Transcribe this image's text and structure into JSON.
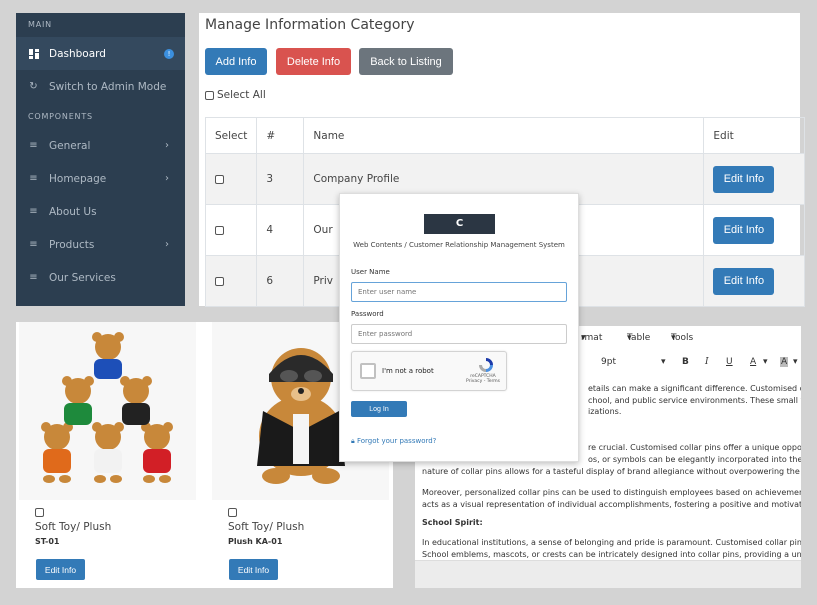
{
  "sidebar": {
    "section_main": "MAIN",
    "section_components": "COMPONENTS",
    "items_main": [
      {
        "label": "Dashboard",
        "badge": "!"
      },
      {
        "label": "Switch to Admin Mode"
      }
    ],
    "items_components": [
      {
        "label": "General"
      },
      {
        "label": "Homepage"
      },
      {
        "label": "About Us"
      },
      {
        "label": "Products"
      },
      {
        "label": "Our Services"
      }
    ]
  },
  "manage": {
    "title": "Manage Information Category",
    "add_label": "Add Info",
    "delete_label": "Delete Info",
    "back_label": "Back to Listing",
    "select_all": "Select All",
    "columns": [
      "Select",
      "#",
      "Name",
      "Edit"
    ],
    "rows": [
      {
        "num": "3",
        "name": "Company Profile",
        "edit": "Edit Info"
      },
      {
        "num": "4",
        "name": "Our",
        "edit": "Edit Info"
      },
      {
        "num": "6",
        "name": "Priv",
        "edit": "Edit Info"
      }
    ]
  },
  "products": [
    {
      "title": "Soft Toy/ Plush",
      "code": "ST-01",
      "edit": "Edit Info"
    },
    {
      "title": "Soft Toy/ Plush",
      "code": "Plush KA-01",
      "edit": "Edit Info"
    }
  ],
  "editor": {
    "menu_format": "rmat",
    "menu_table": "Table",
    "menu_tools": "Tools",
    "font_size": "9pt",
    "tool_bold": "B",
    "tool_italic": "I",
    "tool_underline": "U",
    "tool_color": "A",
    "tool_bg": "A",
    "lines": [
      "etails can make a significant difference. Customised co",
      "chool, and public service environments. These small yet",
      "izations.",
      "re crucial. Customised collar pins offer a unique opportu",
      "os, or symbols can be elegantly incorporated into the d",
      "nature of collar pins allows for a tasteful display of brand allegiance without overpowering the ove",
      "Moreover, personalized collar pins can be used to distinguish employees based on achievements",
      "acts as a visual representation of individual accomplishments, fostering a positive and motivated",
      "School Spirit:",
      "In educational institutions, a sense of belonging and pride is paramount. Customised collar pins s",
      "School emblems, mascots, or crests can be intricately designed into collar pins, providing a uniqu"
    ]
  },
  "login": {
    "logo_text": "C",
    "tagline": "Web Contents / Customer Relationship Management System",
    "username_label": "User Name",
    "username_placeholder": "Enter user name",
    "password_label": "Password",
    "password_placeholder": "Enter password",
    "captcha_text": "I'm not a robot",
    "captcha_brand": "reCAPTCHA",
    "captcha_links": "Privacy - Terms",
    "login_button": "Log In",
    "forgot": "Forgot your password?"
  },
  "colors": {
    "sidebar_bg": "#2c3e50",
    "primary": "#337ab7",
    "danger": "#d9534f",
    "secondary": "#6c757d"
  }
}
